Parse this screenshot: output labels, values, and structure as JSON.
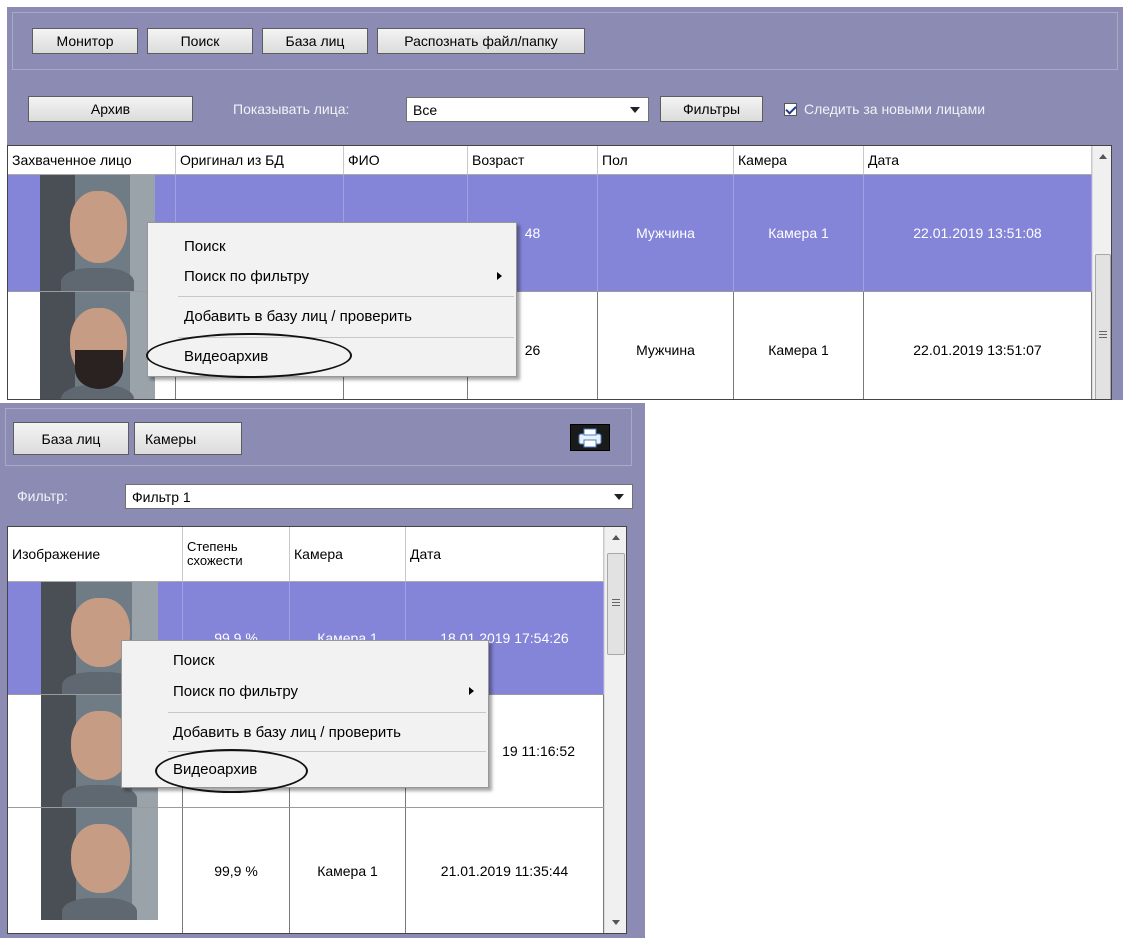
{
  "top": {
    "nav_buttons": [
      "Монитор",
      "Поиск",
      "База лиц",
      "Распознать файл/папку"
    ],
    "archive_button": "Архив",
    "show_faces_label": "Показывать лица:",
    "show_faces_value": "Все",
    "filters_button": "Фильтры",
    "follow_new_checked": true,
    "follow_new_label": "Следить за новыми лицами",
    "columns": [
      "Захваченное лицо",
      "Оригинал из БД",
      "ФИО",
      "Возраст",
      "Пол",
      "Камера",
      "Дата"
    ],
    "rows": [
      {
        "age": "48",
        "sex": "Мужчина",
        "camera": "Камера 1",
        "date": "22.01.2019 13:51:08",
        "selected": true
      },
      {
        "age": "26",
        "sex": "Мужчина",
        "camera": "Камера 1",
        "date": "22.01.2019 13:51:07",
        "selected": false
      }
    ],
    "context_menu": [
      "Поиск",
      "Поиск по фильтру",
      "Добавить в базу лиц / проверить",
      "Видеоархив"
    ]
  },
  "bottom": {
    "tabs": [
      "База лиц",
      "Камеры"
    ],
    "print_icon": "print-icon",
    "filter_label": "Фильтр:",
    "filter_value": "Фильтр 1",
    "columns": [
      "Изображение",
      "Степень схожести",
      "Камера",
      "Дата"
    ],
    "rows": [
      {
        "similarity": "99,9 %",
        "camera": "Камера 1",
        "date": "18.01.2019 17:54:26",
        "selected": true
      },
      {
        "similarity": "",
        "camera": "",
        "date": "19 11:16:52",
        "selected": false
      },
      {
        "similarity": "99,9 %",
        "camera": "Камера 1",
        "date": "21.01.2019 11:35:44",
        "selected": false
      }
    ],
    "context_menu": [
      "Поиск",
      "Поиск по фильтру",
      "Добавить в базу лиц / проверить",
      "Видеоархив"
    ]
  },
  "colors": {
    "panel": "#8b8bb3",
    "selection": "#8484d8"
  }
}
